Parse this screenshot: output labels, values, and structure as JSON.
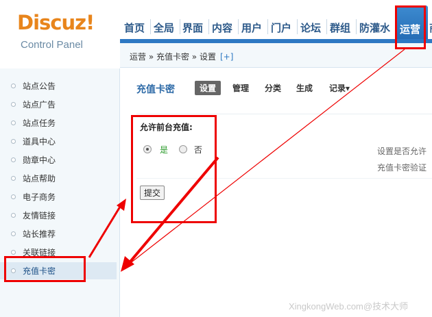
{
  "logo": {
    "main": "Discuz!",
    "sub": "Control Panel"
  },
  "nav": {
    "items": [
      "首页",
      "全局",
      "界面",
      "内容",
      "用户",
      "门户",
      "论坛",
      "群组",
      "防灌水"
    ],
    "active": "运营",
    "overflow": "商"
  },
  "breadcrumb": {
    "text": "运营 » 充值卡密 » 设置",
    "plus": "[+]"
  },
  "sidebar": {
    "items": [
      "站点公告",
      "站点广告",
      "站点任务",
      "道具中心",
      "勋章中心",
      "站点帮助",
      "电子商务",
      "友情链接",
      "站长推荐",
      "关联链接",
      "充值卡密"
    ],
    "active_index": 10
  },
  "main": {
    "title": "充值卡密",
    "tabs": [
      "设置",
      "管理",
      "分类",
      "生成",
      "记录▾"
    ],
    "form_label": "允许前台充值:",
    "option_yes": "是",
    "option_no": "否",
    "desc_line1": "设置是否允许",
    "desc_line2": "充值卡密验证",
    "submit": "提交"
  },
  "watermark": "XingkongWeb.com@技术大师",
  "colors": {
    "accent": "#2d78c3",
    "logo": "#e8851c",
    "annotation": "#ee0000"
  }
}
